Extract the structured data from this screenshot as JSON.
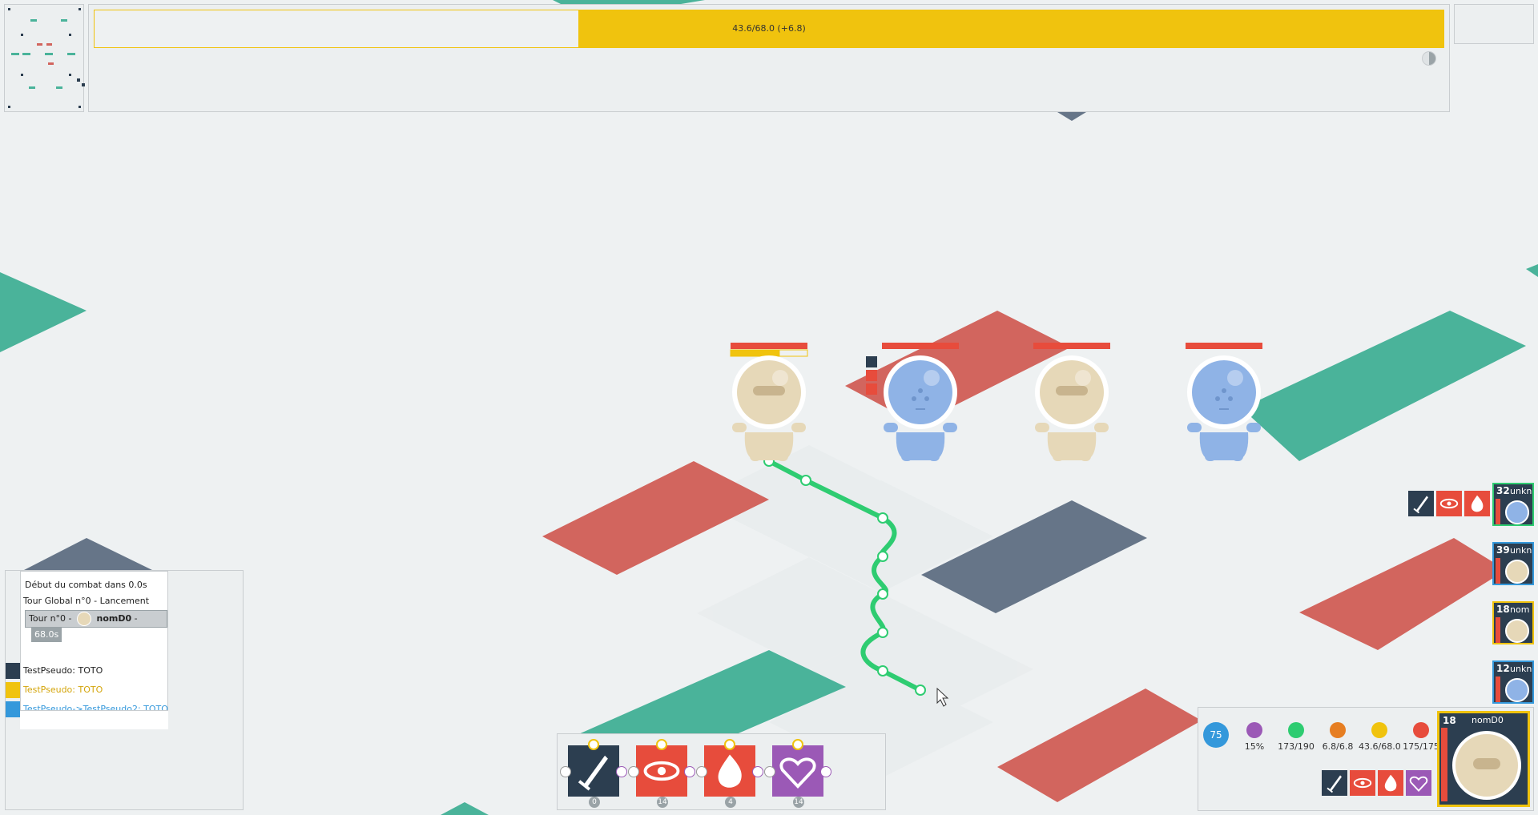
{
  "colors": {
    "teal": "#4ab39a",
    "red": "#d2655e",
    "slate": "#667588",
    "yellow": "#f0c30e",
    "blue": "#3498db",
    "green": "#2ecc71",
    "orange": "#e67e22",
    "hp_red": "#e74c3c",
    "purple": "#9b59b6",
    "dark_navy": "#2c3e50",
    "tan_creature": "#e6d8b8",
    "blue_creature": "#8fb3e6"
  },
  "top_bar": {
    "label": "43.6/68.0 (+6.8)",
    "value": 43.6,
    "max": 68.0,
    "gain": 6.8,
    "icon": "timer-icon"
  },
  "log": {
    "line1": "Début du combat dans 0.0s",
    "line2": "Tour Global n°0 - Lancement",
    "tour_prefix": "Tour n°0 -",
    "tour_name": "nomD0",
    "tour_sep": "-",
    "tour_time": "68.0s",
    "chat": [
      {
        "sender": "TestPseudo",
        "sep": ": ",
        "message": "TOTO",
        "color": "#2c3e50",
        "text_color": "#222222"
      },
      {
        "sender": "TestPseudo",
        "sep": ": ",
        "message": "TOTO",
        "color": "#f0c30e",
        "text_color": "#d4a50b"
      },
      {
        "sender": "TestPseudo->TestPseudo2",
        "sep": ": ",
        "message": "TOTO",
        "color": "#3498db",
        "text_color": "#3498db"
      }
    ]
  },
  "spells": [
    {
      "icon": "sword-icon",
      "bg": "#2c3e50",
      "cooldown": "0"
    },
    {
      "icon": "eye-icon",
      "bg": "#e74c3c",
      "cooldown": "14"
    },
    {
      "icon": "fire-icon",
      "bg": "#e74c3c",
      "cooldown": "4"
    },
    {
      "icon": "heart-icon",
      "bg": "#9b59b6",
      "cooldown": "14"
    }
  ],
  "stats": {
    "level": "75",
    "items": [
      {
        "icon": "crit-icon",
        "label": "15%",
        "color": "#9b59b6"
      },
      {
        "icon": "mp-icon",
        "label": "173/190",
        "color": "#2ecc71"
      },
      {
        "icon": "move-icon",
        "label": "6.8/6.8",
        "color": "#e67e22"
      },
      {
        "icon": "ap-icon",
        "label": "43.6/68.0",
        "color": "#f0c30e"
      },
      {
        "icon": "hp-icon",
        "label": "175/175",
        "color": "#e74c3c"
      }
    ]
  },
  "player": {
    "level": "18",
    "name": "nomD0"
  },
  "timeline": [
    {
      "level": "32",
      "name": "unkn",
      "face": "#8fb3e6",
      "border": "#2ecc71"
    },
    {
      "level": "39",
      "name": "unkn",
      "face": "#e6d8b8",
      "border": "#3498db"
    },
    {
      "level": "18",
      "name": "nom",
      "face": "#e6d8b8",
      "border": "#f0c30e"
    },
    {
      "level": "12",
      "name": "unkn",
      "face": "#8fb3e6",
      "border": "#3498db"
    }
  ],
  "entities": [
    {
      "type": "tan",
      "team": "player",
      "hp": 1.0,
      "ap": 0.64
    },
    {
      "type": "blue",
      "team": "enemy",
      "hp": 1.0
    },
    {
      "type": "tan",
      "team": "enemy",
      "hp": 1.0
    },
    {
      "type": "blue",
      "team": "enemy",
      "hp": 1.0
    }
  ]
}
